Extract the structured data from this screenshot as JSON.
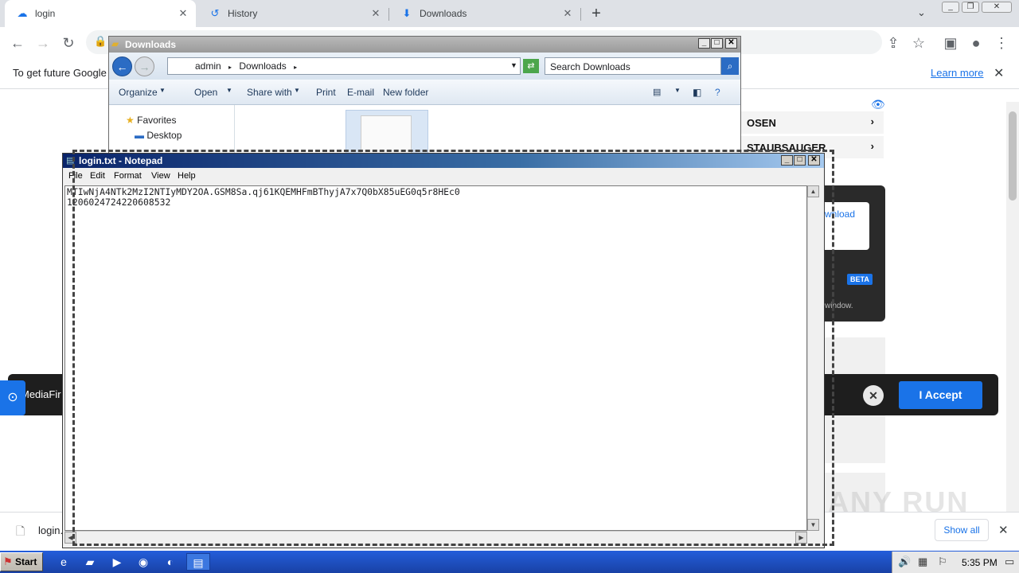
{
  "browser": {
    "tabs": [
      {
        "label": "login",
        "icon": "cloud-icon"
      },
      {
        "label": "History",
        "icon": "history-icon"
      },
      {
        "label": "Downloads",
        "icon": "download-icon"
      }
    ],
    "infobar": {
      "text": "To get future Google",
      "link": "Learn more"
    },
    "download_shelf": {
      "file": "login.",
      "show_all": "Show all"
    }
  },
  "page": {
    "menu_items": [
      "OSEN",
      "STAUBSAUGER"
    ],
    "download_link": "wnload",
    "beta_badge": "BETA",
    "window_hint": "window.",
    "cookie": {
      "brand_text": "MediaFir",
      "accept_label": "I Accept"
    },
    "watermark": "ANY RUN"
  },
  "explorer": {
    "title": "Downloads",
    "breadcrumb": [
      "admin",
      "Downloads"
    ],
    "search_placeholder": "Search Downloads",
    "commands": [
      "Organize",
      "Open",
      "Share with",
      "Print",
      "E-mail",
      "New folder"
    ],
    "nav": {
      "favorites": "Favorites",
      "desktop": "Desktop"
    }
  },
  "notepad": {
    "title": "login.txt - Notepad",
    "menu": [
      "File",
      "Edit",
      "Format",
      "View",
      "Help"
    ],
    "content": "MTIwNjA4NTk2MzI2NTIyMDY2OA.GSM8Sa.qj61KQEMHFmBThyjA7x7Q0bX85uEG0q5r8HEc0\n1206024724220608532"
  },
  "taskbar": {
    "start": "Start",
    "clock": "5:35 PM"
  },
  "colors": {
    "chrome_tabstrip": "#dee1e6",
    "accent_blue": "#1a73e8",
    "taskbar_blue": "#245edb",
    "notepad_title": "#0a246a"
  }
}
